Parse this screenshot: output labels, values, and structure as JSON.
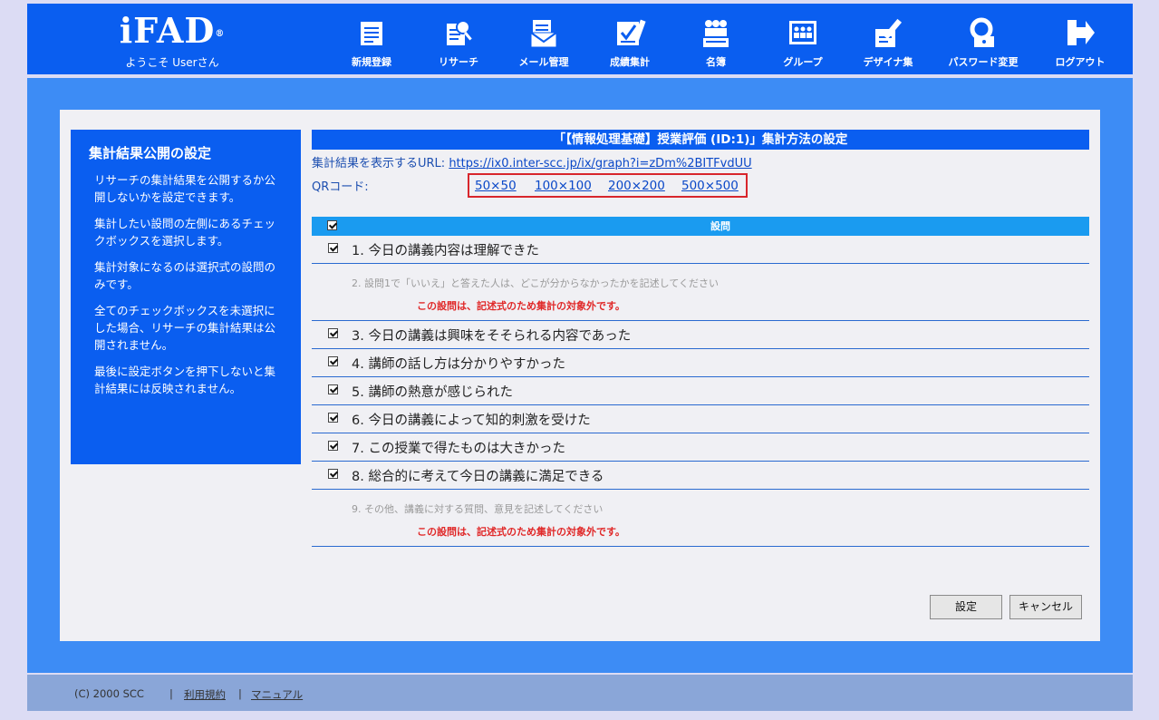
{
  "header": {
    "logo_text": "iFAD",
    "logo_mark": "®",
    "welcome": "ようこそ Userさん",
    "nav": [
      {
        "label": "新規登録",
        "icon": "new-registration-icon"
      },
      {
        "label": "リサーチ",
        "icon": "research-icon"
      },
      {
        "label": "メール管理",
        "icon": "mail-management-icon"
      },
      {
        "label": "成績集計",
        "icon": "grade-tally-icon"
      },
      {
        "label": "名簿",
        "icon": "roster-icon"
      },
      {
        "label": "グループ",
        "icon": "group-icon"
      },
      {
        "label": "デザイナ集",
        "icon": "designer-icon"
      },
      {
        "label": "パスワード変更",
        "icon": "password-change-icon"
      },
      {
        "label": "ログアウト",
        "icon": "logout-icon"
      }
    ]
  },
  "sidebar": {
    "title": "集計結果公開の設定",
    "paragraphs": [
      "リサーチの集計結果を公開するか公開しないかを設定できます。",
      "集計したい設問の左側にあるチェックボックスを選択します。",
      "集計対象になるのは選択式の設問のみです。",
      "全てのチェックボックスを未選択にした場合、リサーチの集計結果は公開されません。",
      "最後に設定ボタンを押下しないと集計結果には反映されません。"
    ]
  },
  "main": {
    "title": "「【情報処理基礎】授業評価 (ID:1)」集計方法の設定",
    "url_label": "集計結果を表示するURL:",
    "url": "https://ix0.inter-scc.jp/ix/graph?i=zDm%2BITFvdUU",
    "qr_label": "QRコード:",
    "qr_sizes": [
      "50×50",
      "100×100",
      "200×200",
      "500×500"
    ],
    "table_header": "設問",
    "questions": [
      "1. 今日の講義内容は理解できた",
      "2. 設問1で「いいえ」と答えた人は、どこが分からなかったかを記述してください",
      "3. 今日の講義は興味をそそられる内容であった",
      "4. 講師の話し方は分かりやすかった",
      "5. 講師の熱意が感じられた",
      "6. 今日の講義によって知的刺激を受けた",
      "7. この授業で得たものは大きかった",
      "8. 総合的に考えて今日の講義に満足できる",
      "9. その他、講義に対する質問、意見を記述してください"
    ],
    "excluded_notice": "この設問は、記述式のため集計の対象外です。",
    "submit_label": "設定",
    "cancel_label": "キャンセル"
  },
  "footer": {
    "copyright": "(C) 2000 SCC",
    "separator": "|",
    "terms": "利用規約",
    "manual": "マニュアル"
  },
  "colors": {
    "header_bg": "#0a5ef0",
    "frame_bg": "#3d8cf5",
    "table_header_bg": "#1a9bf0",
    "notice": "#e02828",
    "highlight_border": "#d8262c"
  }
}
